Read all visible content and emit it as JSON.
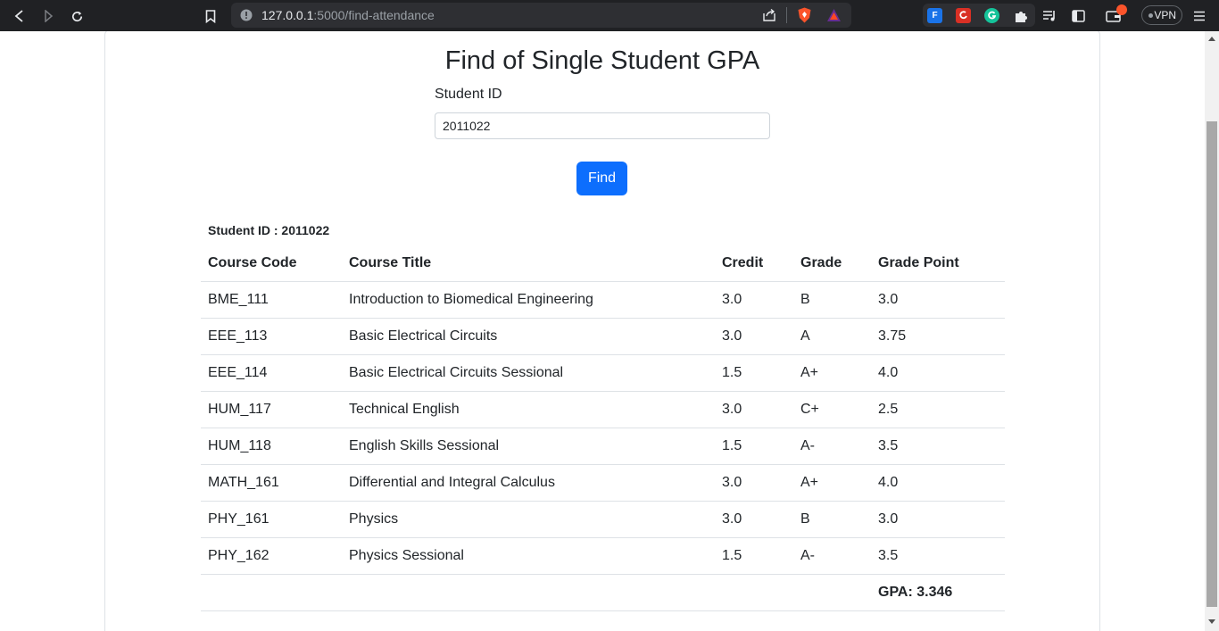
{
  "browser": {
    "url_host": "127.0.0.1",
    "url_path": ":5000/find-attendance",
    "vpn_label": "VPN",
    "ext_f_label": "F"
  },
  "page": {
    "title": "Find of Single Student GPA",
    "student_id_label": "Student ID",
    "student_id_value": "2011022",
    "find_button": "Find",
    "result_label": "Student ID : 2011022"
  },
  "table": {
    "headers": [
      "Course Code",
      "Course Title",
      "Credit",
      "Grade",
      "Grade Point"
    ],
    "rows": [
      [
        "BME_111",
        "Introduction to Biomedical Engineering",
        "3.0",
        "B",
        "3.0"
      ],
      [
        "EEE_113",
        "Basic Electrical Circuits",
        "3.0",
        "A",
        "3.75"
      ],
      [
        "EEE_114",
        "Basic Electrical Circuits Sessional",
        "1.5",
        "A+",
        "4.0"
      ],
      [
        "HUM_117",
        "Technical English",
        "3.0",
        "C+",
        "2.5"
      ],
      [
        "HUM_118",
        "English Skills Sessional",
        "1.5",
        "A-",
        "3.5"
      ],
      [
        "MATH_161",
        "Differential and Integral Calculus",
        "3.0",
        "A+",
        "4.0"
      ],
      [
        "PHY_161",
        "Physics",
        "3.0",
        "B",
        "3.0"
      ],
      [
        "PHY_162",
        "Physics Sessional",
        "1.5",
        "A-",
        "3.5"
      ]
    ],
    "gpa": "GPA: 3.346"
  },
  "colors": {
    "primary": "#0d6efd",
    "toolbar_bg": "#202124",
    "brave_orange": "#fb542b"
  }
}
